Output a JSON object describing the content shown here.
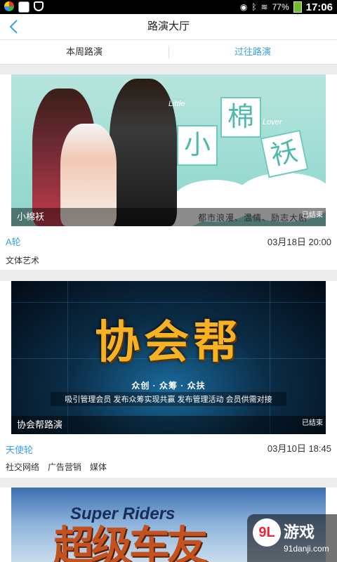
{
  "status_bar": {
    "battery": "77%",
    "time": "17:06"
  },
  "header": {
    "title": "路演大厅"
  },
  "tabs": [
    {
      "label": "本周路演"
    },
    {
      "label": "过往路演"
    }
  ],
  "cards": [
    {
      "banner": {
        "chars": [
          "小",
          "棉",
          "袄"
        ],
        "en_words": [
          "Little",
          "Lover"
        ],
        "slogan": "都市浪漫、温情、励志大剧"
      },
      "caption": "小棉袄",
      "status": "已结束",
      "round": "A轮",
      "date": "03月18日 20:00",
      "tags": [
        "文体艺术"
      ]
    },
    {
      "banner": {
        "headline": "协会帮",
        "line1": "众创 · 众筹 · 众扶",
        "line2": "吸引管理会员 发布众筹实现共赢 发布管理活动 会员供需对接"
      },
      "caption": "协会帮路演",
      "status": "已结束",
      "round": "天使轮",
      "date": "03月10日 18:45",
      "tags": [
        "社交网络",
        "广告营销",
        "媒体"
      ]
    },
    {
      "banner": {
        "en_title": "Super Riders",
        "cn_title": "超级车友"
      }
    }
  ],
  "watermark": {
    "logo": "9L",
    "name": "游戏",
    "url": "91danji.com"
  }
}
